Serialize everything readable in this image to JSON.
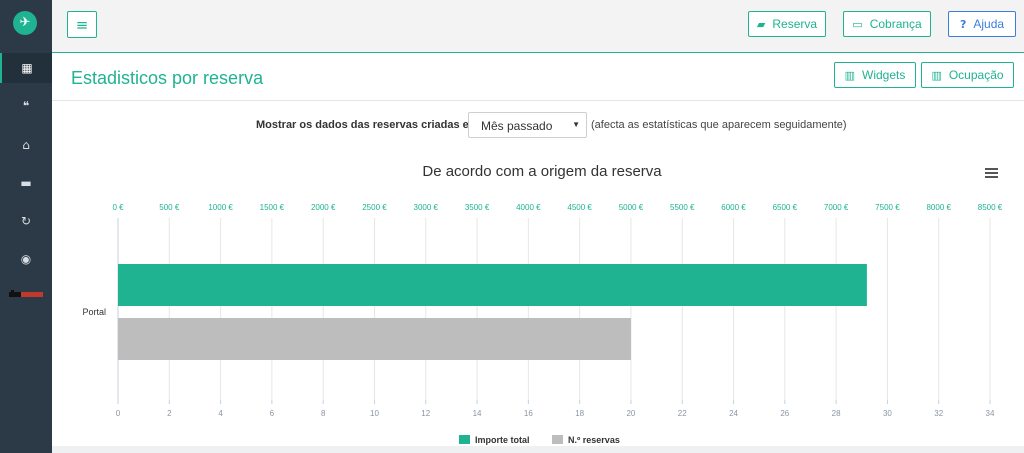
{
  "sidebar": {
    "logo_icon": "rocket-icon",
    "items": [
      {
        "icon": "calendar-icon",
        "glyph": "▦",
        "active": true
      },
      {
        "icon": "chat-icon",
        "glyph": "❝",
        "active": false
      },
      {
        "icon": "home-icon",
        "glyph": "⌂",
        "active": false
      },
      {
        "icon": "briefcase-icon",
        "glyph": "▬",
        "active": false
      },
      {
        "icon": "refresh-icon",
        "glyph": "↻",
        "active": false
      },
      {
        "icon": "globe-icon",
        "glyph": "◉",
        "active": false
      }
    ],
    "partner_logo": "partner-logo"
  },
  "topbar": {
    "menu_glyph": "≡",
    "reserva_label": "Reserva",
    "cobranca_label": "Cobrança",
    "ajuda_label": "Ajuda",
    "ajuda_glyph": "?"
  },
  "header": {
    "title": "Estadisticos por reserva",
    "widgets_label": "Widgets",
    "ocupacao_label": "Ocupação"
  },
  "filter": {
    "label": "Mostrar os dados das reservas criadas em:",
    "selected": "Mês passado",
    "note": "(afecta as estatísticas que aparecem seguidamente)"
  },
  "colors": {
    "accent": "#1fb391",
    "blue": "#3b7ddd",
    "gray_bar": "#bdbdbd",
    "sidebar": "#2b3a46"
  },
  "chart_data": {
    "type": "bar",
    "orientation": "horizontal",
    "title": "De acordo com a origem da reserva",
    "categories": [
      "Portal"
    ],
    "series": [
      {
        "name": "Importe total",
        "values": [
          7300
        ],
        "axis": "top",
        "color": "#1fb391"
      },
      {
        "name": "N.º reservas",
        "values": [
          20
        ],
        "axis": "bottom",
        "color": "#bdbdbd"
      }
    ],
    "top_axis": {
      "min": 0,
      "max": 8500,
      "step": 500,
      "suffix": " €"
    },
    "bottom_axis": {
      "min": 0,
      "max": 34,
      "step": 2
    },
    "grid": true,
    "legend_position": "bottom-center",
    "menu_icon": "hamburger-icon"
  }
}
